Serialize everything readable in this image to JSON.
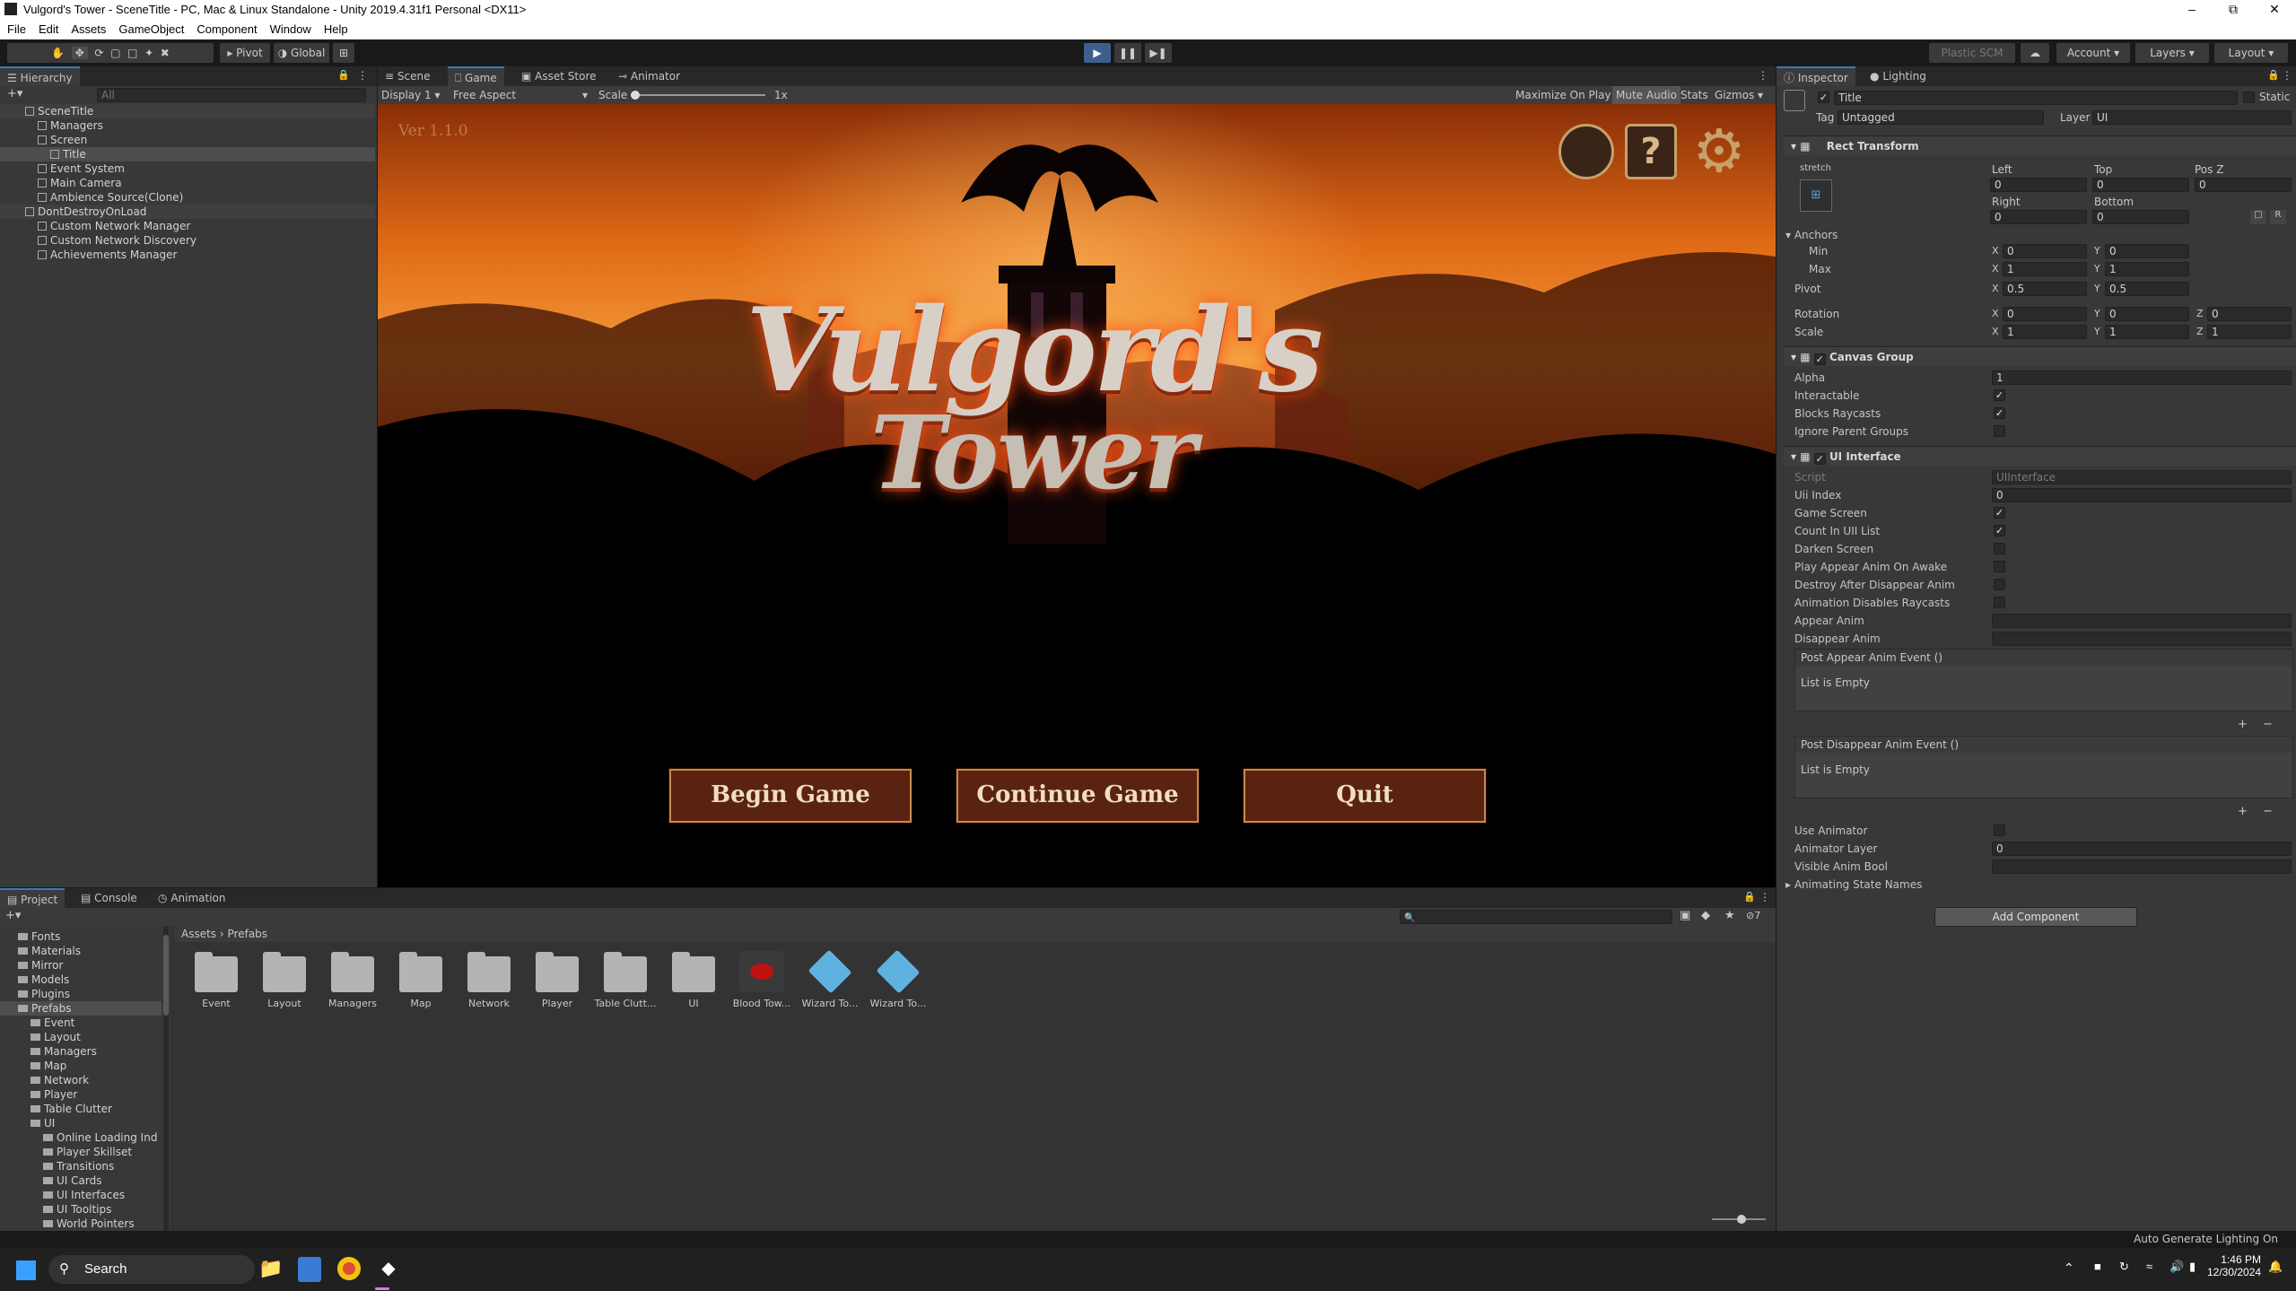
{
  "window": {
    "title": "Vulgord's Tower - SceneTitle - PC, Mac & Linux Standalone - Unity 2019.4.31f1 Personal <DX11>"
  },
  "menu": [
    "File",
    "Edit",
    "Assets",
    "GameObject",
    "Component",
    "Window",
    "Help"
  ],
  "toolbar": {
    "pivot": "Pivot",
    "global": "Global",
    "plastic": "Plastic SCM",
    "account": "Account",
    "layers": "Layers",
    "layout": "Layout"
  },
  "hierarchy": {
    "tab": "Hierarchy",
    "search_placeholder": "All",
    "items": [
      {
        "label": "SceneTitle",
        "level": 0
      },
      {
        "label": "Managers",
        "level": 1
      },
      {
        "label": "Screen",
        "level": 1
      },
      {
        "label": "Title",
        "level": 2
      },
      {
        "label": "Event System",
        "level": 1
      },
      {
        "label": "Main Camera",
        "level": 1
      },
      {
        "label": "Ambience Source(Clone)",
        "level": 1
      },
      {
        "label": "DontDestroyOnLoad",
        "level": 0
      },
      {
        "label": "Custom Network Manager",
        "level": 1
      },
      {
        "label": "Custom Network Discovery",
        "level": 1
      },
      {
        "label": "Achievements Manager",
        "level": 1
      }
    ]
  },
  "center_tabs": {
    "scene": "Scene",
    "game": "Game",
    "asset_store": "Asset Store",
    "animator": "Animator"
  },
  "game_toolbar": {
    "display": "Display 1",
    "aspect": "Free Aspect",
    "scale_label": "Scale",
    "scale_value": "1x",
    "maximize": "Maximize On Play",
    "mute": "Mute Audio",
    "stats": "Stats",
    "gizmos": "Gizmos"
  },
  "game": {
    "version": "Ver 1.1.0",
    "logo_line1": "Vulgord's",
    "logo_line2": "Tower",
    "buttons": [
      "Begin Game",
      "Continue Game",
      "Quit"
    ],
    "icons": [
      "discord-icon",
      "help-icon",
      "settings-gear-icon"
    ]
  },
  "inspector": {
    "tabs": {
      "inspector": "Inspector",
      "lighting": "Lighting"
    },
    "object_name": "Title",
    "static": "Static",
    "tag_label": "Tag",
    "tag_value": "Untagged",
    "layer_label": "Layer",
    "layer_value": "UI",
    "rect": {
      "header": "Rect Transform",
      "stretch": "stretch",
      "left": "Left",
      "top": "Top",
      "posz": "Pos Z",
      "right": "Right",
      "bottom": "Bottom",
      "left_v": "0",
      "top_v": "0",
      "posz_v": "0",
      "right_v": "0",
      "bottom_v": "0",
      "anchors": "Anchors",
      "min": "Min",
      "max": "Max",
      "pivot": "Pivot",
      "rotation": "Rotation",
      "scale": "Scale",
      "min_x": "0",
      "min_y": "0",
      "max_x": "1",
      "max_y": "1",
      "pivot_x": "0.5",
      "pivot_y": "0.5",
      "rot_x": "0",
      "rot_y": "0",
      "rot_z": "0",
      "scale_x": "1",
      "scale_y": "1",
      "scale_z": "1"
    },
    "canvas_group": {
      "header": "Canvas Group",
      "alpha": "Alpha",
      "alpha_v": "1",
      "interactable": "Interactable",
      "blocks": "Blocks Raycasts",
      "ignore": "Ignore Parent Groups"
    },
    "ui_interface": {
      "header": "UI Interface",
      "script": "Script",
      "script_v": "UIInterface",
      "uii_index": "Uii Index",
      "uii_index_v": "0",
      "game_screen": "Game Screen",
      "count": "Count In UII List",
      "darken": "Darken Screen",
      "play_appear": "Play Appear Anim On Awake",
      "destroy": "Destroy After Disappear Anim",
      "anim_disables": "Animation Disables Raycasts",
      "appear": "Appear Anim",
      "disappear": "Disappear Anim",
      "post_appear": "Post Appear Anim Event ()",
      "post_disappear": "Post Disappear Anim Event ()",
      "empty": "List is Empty",
      "use_animator": "Use Animator",
      "animator_layer": "Animator Layer",
      "animator_layer_v": "0",
      "visible_bool": "Visible Anim Bool",
      "animating": "Animating State Names"
    },
    "add_component": "Add Component"
  },
  "project": {
    "tabs": {
      "project": "Project",
      "console": "Console",
      "animation": "Animation"
    },
    "tree": [
      {
        "label": "Fonts",
        "level": 1
      },
      {
        "label": "Materials",
        "level": 1
      },
      {
        "label": "Mirror",
        "level": 1
      },
      {
        "label": "Models",
        "level": 1
      },
      {
        "label": "Plugins",
        "level": 1
      },
      {
        "label": "Prefabs",
        "level": 1
      },
      {
        "label": "Event",
        "level": 2
      },
      {
        "label": "Layout",
        "level": 2
      },
      {
        "label": "Managers",
        "level": 2
      },
      {
        "label": "Map",
        "level": 2
      },
      {
        "label": "Network",
        "level": 2
      },
      {
        "label": "Player",
        "level": 2
      },
      {
        "label": "Table Clutter",
        "level": 2
      },
      {
        "label": "UI",
        "level": 2
      },
      {
        "label": "Online Loading Ind",
        "level": 3
      },
      {
        "label": "Player Skillset",
        "level": 3
      },
      {
        "label": "Transitions",
        "level": 3
      },
      {
        "label": "UI Cards",
        "level": 3
      },
      {
        "label": "UI Interfaces",
        "level": 3
      },
      {
        "label": "UI Tooltips",
        "level": 3
      },
      {
        "label": "World Pointers",
        "level": 3
      }
    ],
    "breadcrumb": [
      "Assets",
      "Prefabs"
    ],
    "assets": [
      {
        "label": "Event",
        "kind": "folder"
      },
      {
        "label": "Layout",
        "kind": "folder"
      },
      {
        "label": "Managers",
        "kind": "folder"
      },
      {
        "label": "Map",
        "kind": "folder"
      },
      {
        "label": "Network",
        "kind": "folder"
      },
      {
        "label": "Player",
        "kind": "folder"
      },
      {
        "label": "Table Clutt...",
        "kind": "folder"
      },
      {
        "label": "UI",
        "kind": "folder"
      },
      {
        "label": "Blood Tow...",
        "kind": "prefab-blood"
      },
      {
        "label": "Wizard To...",
        "kind": "prefab-cube"
      },
      {
        "label": "Wizard To...",
        "kind": "prefab-cube"
      }
    ],
    "hidden_count": "7"
  },
  "status": {
    "lighting": "Auto Generate Lighting On"
  },
  "taskbar": {
    "search": "Search",
    "time": "1:46 PM",
    "date": "12/30/2024"
  }
}
